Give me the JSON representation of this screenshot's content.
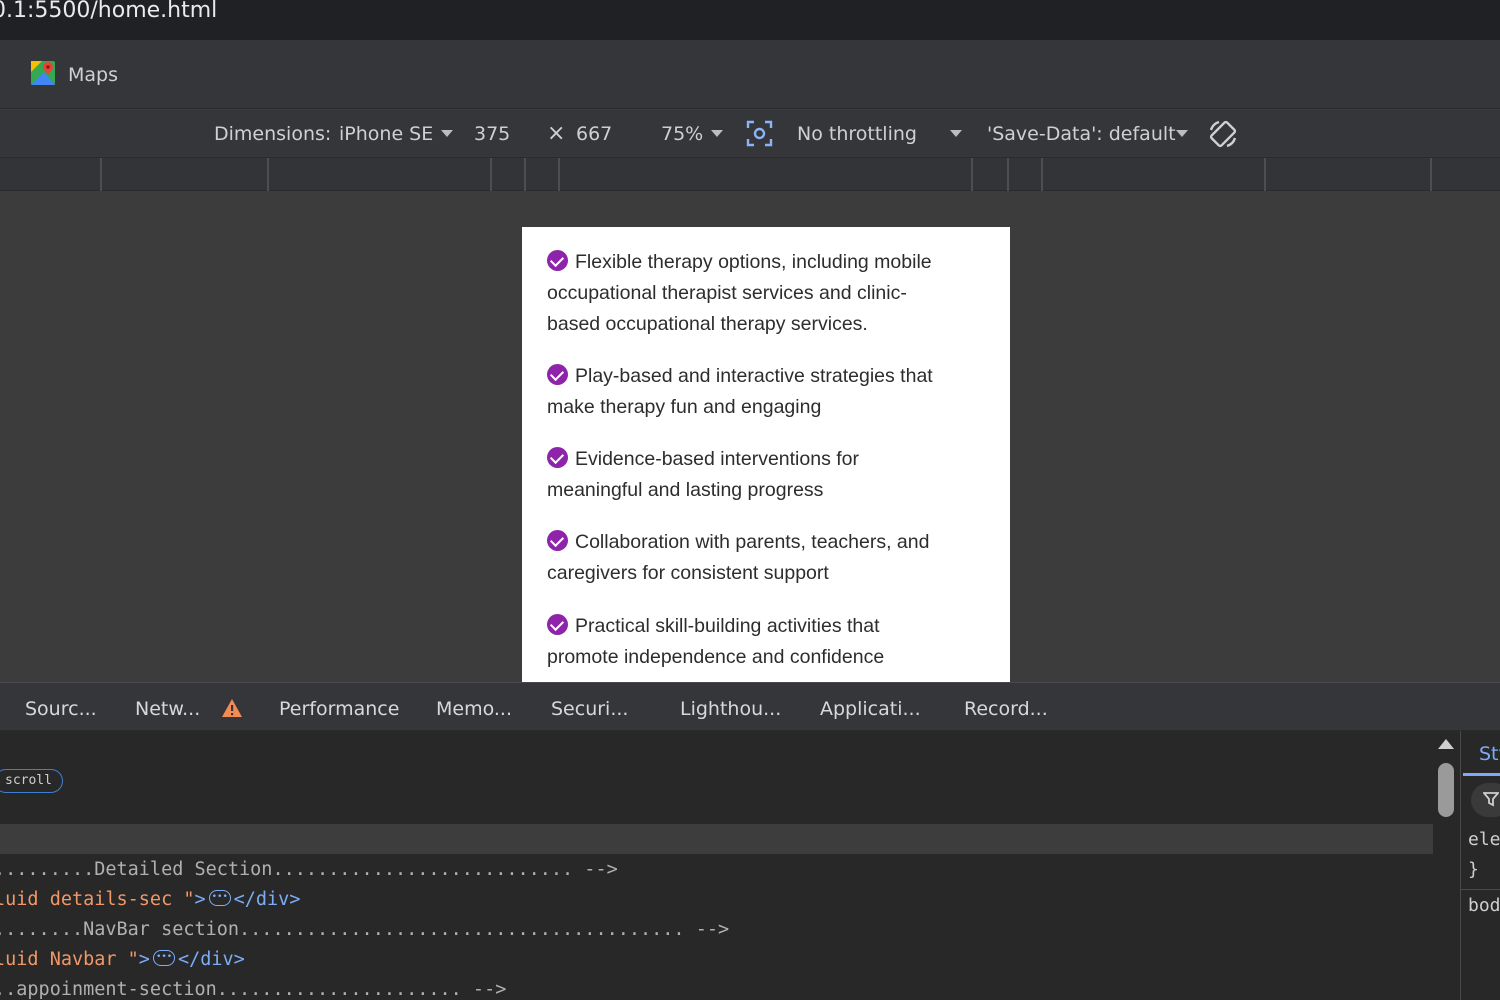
{
  "browser": {
    "url": "0.1:5500/home.html",
    "bookmarks": [
      {
        "label": "Maps",
        "icon": "google-maps-icon"
      }
    ]
  },
  "device_toolbar": {
    "dimensions_label": "Dimensions:",
    "device": "iPhone SE",
    "width": "375",
    "times": "×",
    "height": "667",
    "zoom": "75%",
    "throttling": "No throttling",
    "save_data": "'Save-Data': default",
    "icons": [
      "capture-screenshot-icon",
      "rotate-icon"
    ],
    "accent_color": "#8ab4f8"
  },
  "page": {
    "check_color": "#8e24aa",
    "features": [
      {
        "line1": "Flexible therapy options, including mobile",
        "line2": "occupational therapist services and clinic-",
        "line3": "based occupational therapy services."
      },
      {
        "line1": "Play-based and interactive strategies that",
        "line2": "make therapy fun and engaging"
      },
      {
        "line1": "Evidence-based interventions for",
        "line2": "meaningful and lasting progress"
      },
      {
        "line1": "Collaboration with parents, teachers, and",
        "line2": "caregivers for consistent support"
      },
      {
        "line1": "Practical skill-building activities that",
        "line2": "promote independence and confidence"
      }
    ]
  },
  "devtools": {
    "tabs": [
      "Sourc...",
      "Netw...",
      "Performance",
      "Memo...",
      "Securi...",
      "Lighthou...",
      "Applicati...",
      "Record..."
    ],
    "warning_color": "#f28b54",
    "scroll_badge": "scroll",
    "code": [
      {
        "comment": ".........Detailed Section........................... -->"
      },
      {
        "attr": "luid details-sec \"",
        "tag_open": ">",
        "tag_close": "</div>"
      },
      {
        "comment": "........NavBar section........................................ -->"
      },
      {
        "attr": "luid Navbar \"",
        "tag_open": ">",
        "tag_close": "</div>"
      },
      {
        "comment": "..appoinment-section...................... -->"
      }
    ],
    "styles_tab": "Sty",
    "styles_lines": [
      "ele",
      "}",
      "bod"
    ]
  }
}
